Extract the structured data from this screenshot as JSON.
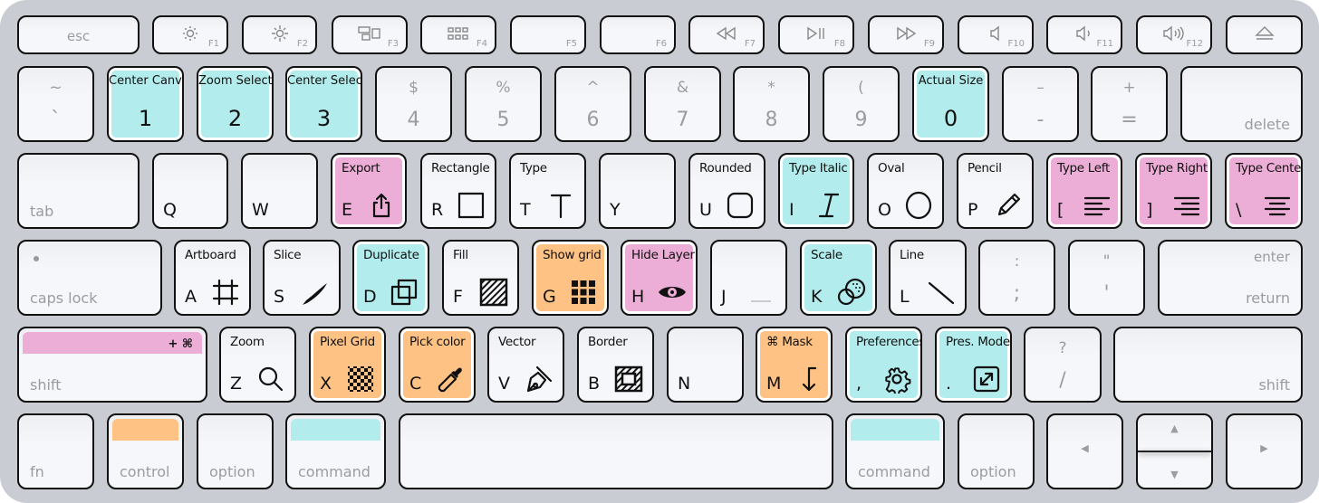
{
  "colors": {
    "teal": "#b2ecec",
    "pink": "#ecadd6",
    "orange": "#ffc285",
    "key": "#f4f5f8",
    "background": "#c9ccd3"
  },
  "rows": [
    {
      "keys": [
        {
          "type": "esc",
          "main": "esc"
        },
        {
          "type": "fn",
          "main": "F1",
          "icon": "brightness-down-icon"
        },
        {
          "type": "fn",
          "main": "F2",
          "icon": "brightness-up-icon"
        },
        {
          "type": "fn",
          "main": "F3",
          "icon": "mission-control-icon"
        },
        {
          "type": "fn",
          "main": "F4",
          "icon": "launchpad-icon"
        },
        {
          "type": "fn",
          "main": "F5"
        },
        {
          "type": "fn",
          "main": "F6"
        },
        {
          "type": "fn",
          "main": "F7",
          "icon": "rewind-icon"
        },
        {
          "type": "fn",
          "main": "F8",
          "icon": "play-pause-icon"
        },
        {
          "type": "fn",
          "main": "F9",
          "icon": "fast-forward-icon"
        },
        {
          "type": "fn",
          "main": "F10",
          "icon": "mute-icon"
        },
        {
          "type": "fn",
          "main": "F11",
          "icon": "volume-down-icon"
        },
        {
          "type": "fn",
          "main": "F12",
          "icon": "volume-up-icon"
        },
        {
          "type": "fn",
          "main": "",
          "icon": "eject-icon"
        }
      ]
    },
    {
      "keys": [
        {
          "type": "num",
          "shift": "~",
          "main": "`"
        },
        {
          "type": "num",
          "main": "1",
          "action": "Center Canvas",
          "color": "teal"
        },
        {
          "type": "num",
          "main": "2",
          "action": "Zoom Selection",
          "color": "teal"
        },
        {
          "type": "num",
          "main": "3",
          "action": "Center Selection",
          "color": "teal"
        },
        {
          "type": "num",
          "shift": "$",
          "main": "4"
        },
        {
          "type": "num",
          "shift": "%",
          "main": "5"
        },
        {
          "type": "num",
          "shift": "^",
          "main": "6"
        },
        {
          "type": "num",
          "shift": "&",
          "main": "7"
        },
        {
          "type": "num",
          "shift": "*",
          "main": "8"
        },
        {
          "type": "num",
          "shift": "(",
          "main": "9"
        },
        {
          "type": "num",
          "main": "0",
          "action": "Actual Size",
          "color": "teal"
        },
        {
          "type": "num",
          "shift": "–",
          "main": "-"
        },
        {
          "type": "num",
          "shift": "+",
          "main": "="
        },
        {
          "type": "modr",
          "main": "delete"
        }
      ]
    },
    {
      "keys": [
        {
          "type": "modl",
          "main": "tab"
        },
        {
          "type": "letter",
          "main": "Q"
        },
        {
          "type": "letter",
          "main": "W"
        },
        {
          "type": "letter",
          "main": "E",
          "action": "Export",
          "color": "pink",
          "icon": "export-icon"
        },
        {
          "type": "letter",
          "main": "R",
          "action": "Rectangle",
          "icon": "rectangle-icon"
        },
        {
          "type": "letter",
          "main": "T",
          "action": "Type",
          "icon": "type-icon"
        },
        {
          "type": "letter",
          "main": "Y"
        },
        {
          "type": "letter",
          "main": "U",
          "action": "Rounded",
          "icon": "rounded-rectangle-icon"
        },
        {
          "type": "letter",
          "main": "I",
          "action": "Type Italic",
          "color": "teal",
          "icon": "italic-icon"
        },
        {
          "type": "letter",
          "main": "O",
          "action": "Oval",
          "icon": "oval-icon"
        },
        {
          "type": "letter",
          "main": "P",
          "action": "Pencil",
          "icon": "pencil-icon"
        },
        {
          "type": "letter",
          "main": "[",
          "action": "Type Left",
          "color": "pink",
          "icon": "align-left-icon"
        },
        {
          "type": "letter",
          "main": "]",
          "action": "Type Right",
          "color": "pink",
          "icon": "align-right-icon"
        },
        {
          "type": "letter",
          "main": "\\",
          "action": "Type Center",
          "color": "pink",
          "icon": "align-center-icon"
        }
      ]
    },
    {
      "keys": [
        {
          "type": "caps",
          "main": "caps lock"
        },
        {
          "type": "letter",
          "main": "A",
          "action": "Artboard",
          "icon": "artboard-icon"
        },
        {
          "type": "letter",
          "main": "S",
          "action": "Slice",
          "icon": "slice-icon"
        },
        {
          "type": "letter",
          "main": "D",
          "action": "Duplicate",
          "color": "teal",
          "icon": "duplicate-icon"
        },
        {
          "type": "letter",
          "main": "F",
          "action": "Fill",
          "icon": "fill-icon"
        },
        {
          "type": "letter",
          "main": "G",
          "action": "Show grid",
          "color": "orange",
          "icon": "grid-icon"
        },
        {
          "type": "letter",
          "main": "H",
          "action": "Hide Layer",
          "color": "pink",
          "icon": "eye-icon"
        },
        {
          "type": "letter",
          "main": "J",
          "icon": "home-bump-icon"
        },
        {
          "type": "letter",
          "main": "K",
          "action": "Scale",
          "color": "teal",
          "icon": "scale-icon"
        },
        {
          "type": "letter",
          "main": "L",
          "action": "Line",
          "icon": "line-icon"
        },
        {
          "type": "num",
          "shift": ":",
          "main": ";"
        },
        {
          "type": "num",
          "shift": "\"",
          "main": "'"
        },
        {
          "type": "return",
          "main": "return",
          "extra": "enter"
        }
      ]
    },
    {
      "keys": [
        {
          "type": "shiftl",
          "main": "shift",
          "bar": "pink",
          "bar_text": "+ ⌘"
        },
        {
          "type": "letter",
          "main": "Z",
          "action": "Zoom",
          "icon": "zoom-icon"
        },
        {
          "type": "letter",
          "main": "X",
          "action": "Pixel Grid",
          "color": "orange",
          "icon": "pixel-grid-icon"
        },
        {
          "type": "letter",
          "main": "C",
          "action": "Pick color",
          "color": "orange",
          "icon": "eyedropper-icon"
        },
        {
          "type": "letter",
          "main": "V",
          "action": "Vector",
          "icon": "pen-tool-icon"
        },
        {
          "type": "letter",
          "main": "B",
          "action": "Border",
          "icon": "border-icon"
        },
        {
          "type": "letter",
          "main": "N"
        },
        {
          "type": "letter",
          "main": "M",
          "action": "⌘ Mask",
          "color": "orange",
          "icon": "mask-arrow-icon"
        },
        {
          "type": "letter",
          "main": ",",
          "action": "Preferences",
          "color": "teal",
          "icon": "gear-icon"
        },
        {
          "type": "letter",
          "main": ".",
          "action": "Pres. Mode",
          "color": "teal",
          "icon": "expand-icon"
        },
        {
          "type": "num",
          "shift": "?",
          "main": "/"
        },
        {
          "type": "modr",
          "main": "shift"
        }
      ]
    },
    {
      "keys": [
        {
          "type": "modl",
          "main": "fn"
        },
        {
          "type": "modl",
          "main": "control",
          "bar": "orange"
        },
        {
          "type": "modl",
          "main": "option"
        },
        {
          "type": "modl",
          "main": "command",
          "bar": "teal"
        },
        {
          "type": "space",
          "main": ""
        },
        {
          "type": "modl",
          "main": "command",
          "bar": "teal"
        },
        {
          "type": "modl",
          "main": "option"
        },
        {
          "type": "arrow",
          "main": "◀",
          "icon": "arrow-left-icon"
        },
        {
          "type": "updown",
          "main": "▲",
          "extra": "▼"
        },
        {
          "type": "arrow",
          "main": "▶",
          "icon": "arrow-right-icon"
        }
      ]
    }
  ]
}
